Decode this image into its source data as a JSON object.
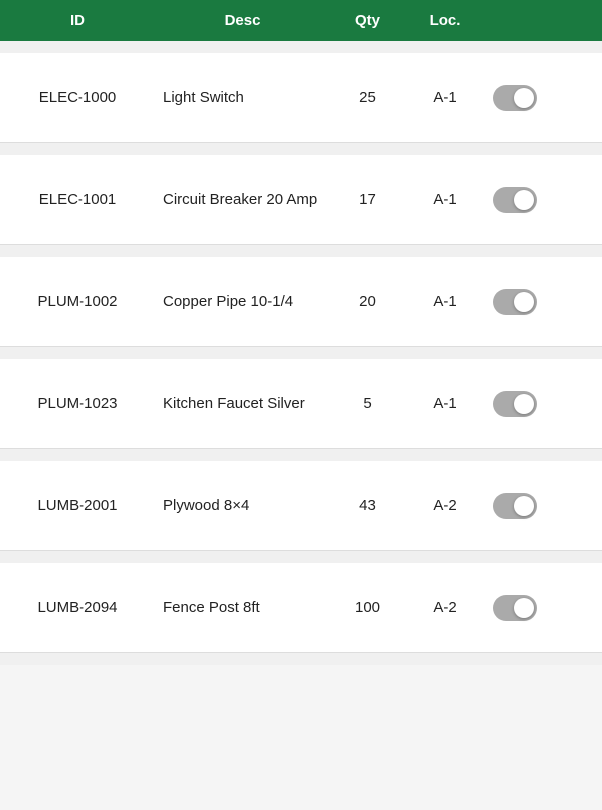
{
  "header": {
    "col_id": "ID",
    "col_desc": "Desc",
    "col_qty": "Qty",
    "col_loc": "Loc."
  },
  "rows": [
    {
      "id": "ELEC-1000",
      "desc": "Light Switch",
      "qty": "25",
      "loc": "A-1",
      "toggle_state": false
    },
    {
      "id": "ELEC-1001",
      "desc": "Circuit Breaker 20 Amp",
      "qty": "17",
      "loc": "A-1",
      "toggle_state": false
    },
    {
      "id": "PLUM-1002",
      "desc": "Copper Pipe 10-1/4",
      "qty": "20",
      "loc": "A-1",
      "toggle_state": false
    },
    {
      "id": "PLUM-1023",
      "desc": "Kitchen Faucet Silver",
      "qty": "5",
      "loc": "A-1",
      "toggle_state": false
    },
    {
      "id": "LUMB-2001",
      "desc": "Plywood 8×4",
      "qty": "43",
      "loc": "A-2",
      "toggle_state": false
    },
    {
      "id": "LUMB-2094",
      "desc": "Fence Post 8ft",
      "qty": "100",
      "loc": "A-2",
      "toggle_state": false
    }
  ]
}
